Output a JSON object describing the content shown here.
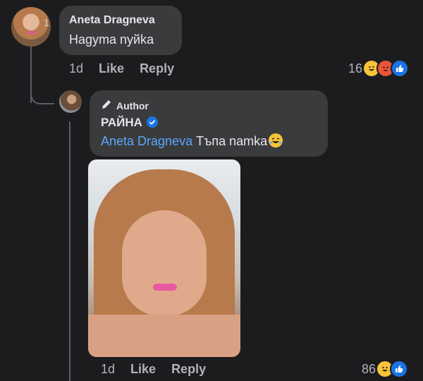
{
  "comment": {
    "avatar_badge": "1",
    "author": "Aneta Dragneva",
    "text": "Нagyma nyйka",
    "time": "1d",
    "like_label": "Like",
    "reply_label": "Reply",
    "reaction_count": "16",
    "reactions": [
      "haha",
      "angry",
      "like"
    ]
  },
  "reply": {
    "author_badge": "Author",
    "author": "РАЙНА",
    "verified": true,
    "mention": "Aneta Dragneva",
    "text": "Тъпа namka",
    "emoji": "rolling-on-floor-laughing",
    "time": "1d",
    "like_label": "Like",
    "reply_label": "Reply",
    "reaction_count": "86",
    "reactions": [
      "haha",
      "like"
    ]
  },
  "colors": {
    "background": "#1c1c1e",
    "bubble": "#3a3b3c",
    "mention": "#5aa7ff",
    "muted_text": "#b0b3b8",
    "verified": "#1b74e4"
  }
}
